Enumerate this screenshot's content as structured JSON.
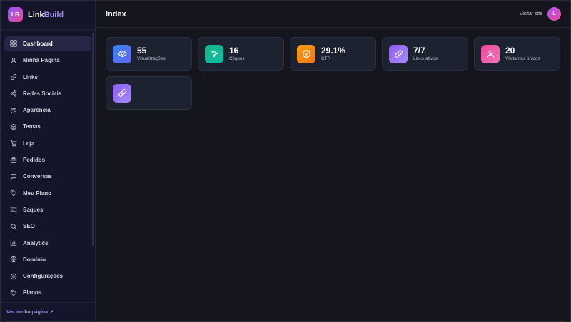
{
  "brand": {
    "logo": "LB",
    "name_a": "Link",
    "name_b": "Build"
  },
  "sidebar": {
    "items": [
      {
        "label": "Dashboard",
        "icon": "grid-icon",
        "active": true
      },
      {
        "label": "Minha Página",
        "icon": "user-icon"
      },
      {
        "label": "Links",
        "icon": "link-icon"
      },
      {
        "label": "Redes Sociais",
        "icon": "share-icon"
      },
      {
        "label": "Aparência",
        "icon": "palette-icon"
      },
      {
        "label": "Temas",
        "icon": "layers-icon"
      },
      {
        "label": "Loja",
        "icon": "cart-icon"
      },
      {
        "label": "Pedidos",
        "icon": "package-icon"
      },
      {
        "label": "Conversas",
        "icon": "chat-icon"
      },
      {
        "label": "Meu Plano",
        "icon": "tag-icon"
      },
      {
        "label": "Saques",
        "icon": "wallet-icon"
      },
      {
        "label": "SEO",
        "icon": "search-icon"
      },
      {
        "label": "Analytics",
        "icon": "bar-chart-icon"
      },
      {
        "label": "Domínio",
        "icon": "globe-icon"
      },
      {
        "label": "Configurações",
        "icon": "gear-icon"
      },
      {
        "label": "Planos",
        "icon": "tag-icon"
      }
    ],
    "footer_link": "Ver minha página ↗"
  },
  "header": {
    "title": "Index",
    "visit_label": "Visitar site",
    "avatar_initial": "L"
  },
  "stats": [
    {
      "value": "55",
      "label": "Visualizações",
      "icon": "eye-icon",
      "color_from": "#3b82f6",
      "color_to": "#6366f1"
    },
    {
      "value": "16",
      "label": "Cliques",
      "icon": "cursor-icon",
      "color_from": "#10b981",
      "color_to": "#14b8a6"
    },
    {
      "value": "29.1%",
      "label": "CTR",
      "icon": "check-circle-icon",
      "color_from": "#f59e0b",
      "color_to": "#f97316"
    },
    {
      "value": "7/7",
      "label": "Links ativos",
      "icon": "link-icon",
      "color_from": "#8b5cf6",
      "color_to": "#a78bfa"
    },
    {
      "value": "20",
      "label": "Visitantes únicos",
      "icon": "user-icon",
      "color_from": "#ec4899",
      "color_to": "#f472b6"
    },
    {
      "value": "",
      "label": "",
      "icon": "link-icon",
      "color_from": "#8b5cf6",
      "color_to": "#a78bfa"
    }
  ]
}
